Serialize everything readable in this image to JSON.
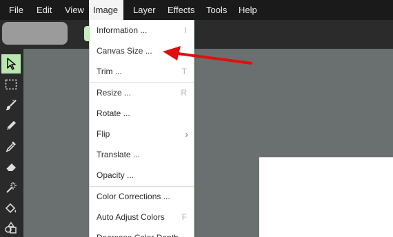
{
  "menubar": {
    "items": [
      "File",
      "Edit",
      "View",
      "Image",
      "Layer",
      "Effects",
      "Tools",
      "Help"
    ],
    "active": "Image"
  },
  "image_menu": {
    "items": [
      {
        "label": "Information ...",
        "shortcut": "I"
      },
      {
        "label": "Canvas Size ...",
        "shortcut": ""
      },
      {
        "label": "Trim ...",
        "shortcut": "T"
      },
      {
        "label": "Resize ...",
        "shortcut": "R"
      },
      {
        "label": "Rotate ...",
        "shortcut": ""
      },
      {
        "label": "Flip",
        "shortcut": ""
      },
      {
        "label": "Translate ...",
        "shortcut": ""
      },
      {
        "label": "Opacity ...",
        "shortcut": ""
      },
      {
        "label": "Color Corrections ...",
        "shortcut": ""
      },
      {
        "label": "Auto Adjust Colors",
        "shortcut": "F"
      },
      {
        "label": "Decrease Color Depth ...",
        "shortcut": ""
      }
    ],
    "flip_submenu_indicator": "chevron-right-icon"
  },
  "tools": [
    {
      "icon": "pointer-arrow-icon",
      "selected": true
    },
    {
      "icon": "selection-rectangle-icon",
      "selected": false
    },
    {
      "icon": "brush-icon",
      "selected": false
    },
    {
      "icon": "pencil-icon",
      "selected": false
    },
    {
      "icon": "eyedropper-icon",
      "selected": false
    },
    {
      "icon": "eraser-icon",
      "selected": false
    },
    {
      "icon": "magic-wand-icon",
      "selected": false
    },
    {
      "icon": "paint-bucket-icon",
      "selected": false
    },
    {
      "icon": "shapes-icon",
      "selected": false
    }
  ],
  "colors": {
    "menubar_bg": "#1a1a1a",
    "canvas_bg": "#6a706f",
    "tool_selected": "#b9e7b0",
    "annotation_arrow": "#e01010"
  }
}
